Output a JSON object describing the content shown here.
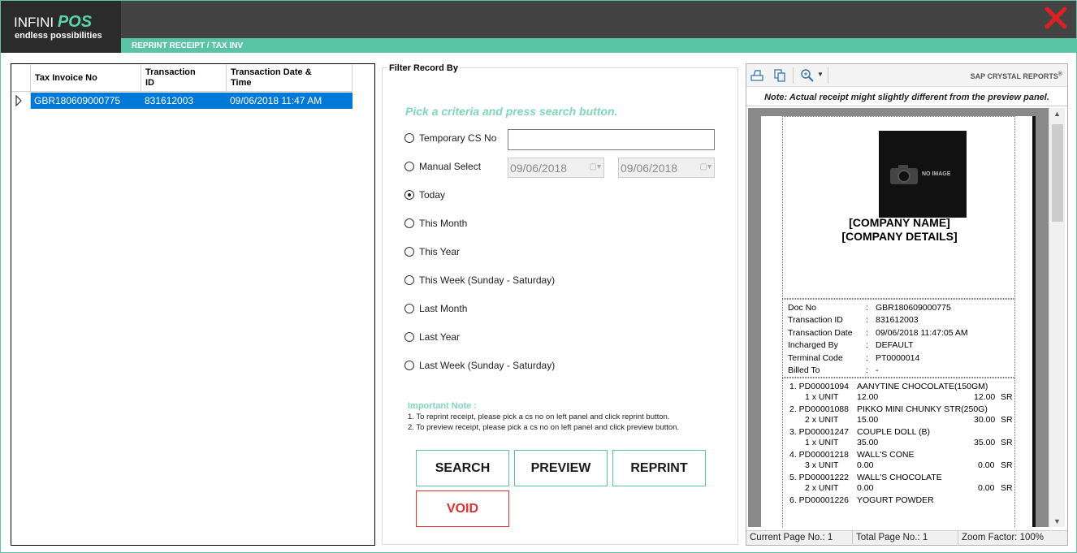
{
  "header": {
    "logo_brand": "INFINI",
    "logo_pos": "POS",
    "logo_tagline": "endless possibilities",
    "subtitle": "REPRINT RECEIPT / TAX INV"
  },
  "grid": {
    "columns": [
      "Tax Invoice No",
      "Transaction ID",
      "Transaction Date & Time"
    ],
    "col_id_l1": "Transaction",
    "col_id_l2": "ID",
    "col_dt_l1": "Transaction Date &",
    "col_dt_l2": "Time",
    "rows": [
      {
        "tax_invoice_no": "GBR180609000775",
        "transaction_id": "831612003",
        "transaction_dt": "09/06/2018 11:47 AM"
      }
    ]
  },
  "filter": {
    "legend": "Filter Record By",
    "hint": "Pick a criteria and press search button.",
    "options": [
      "Temporary CS No",
      "Manual Select",
      "Today",
      "This Month",
      "This Year",
      "This Week (Sunday - Saturday)",
      "Last Month",
      "Last Year",
      "Last Week (Sunday - Saturday)"
    ],
    "selected": "Today",
    "temp_cs_value": "",
    "date_from": "09/06/2018",
    "date_to": "09/06/2018",
    "note_title": "Important Note :",
    "note_1": "1. To reprint receipt, please pick a cs no on left panel and click reprint button.",
    "note_2": "2. To preview receipt, please pick a cs no on left panel and click preview button."
  },
  "buttons": {
    "search": "SEARCH",
    "preview": "PREVIEW",
    "reprint": "REPRINT",
    "void": "VOID"
  },
  "viewer": {
    "brand": "SAP CRYSTAL REPORTS",
    "brand_mark": "®",
    "note": "Note: Actual receipt might slightly different from the preview panel.",
    "current_page": "Current Page No.: 1",
    "total_page": "Total Page No.: 1",
    "zoom": "Zoom Factor: 100%"
  },
  "receipt": {
    "no_image": "NO IMAGE",
    "company_name": "[COMPANY NAME]",
    "company_details": "[COMPANY DETAILS]",
    "fields": [
      {
        "label": "Doc No",
        "value": "GBR180609000775"
      },
      {
        "label": "Transaction ID",
        "value": "831612003"
      },
      {
        "label": "Transaction Date",
        "value": "09/06/2018 11:47:05 AM"
      },
      {
        "label": "Incharged By",
        "value": "DEFAULT"
      },
      {
        "label": "Terminal Code",
        "value": "PT0000014"
      },
      {
        "label": "Billed To",
        "value": "-"
      }
    ],
    "items": [
      {
        "line1": "1. PD00001094",
        "name": "AANYTINE CHOCOLATE(150GM)",
        "qty": "1 x UNIT",
        "price": "12.00",
        "amount": "12.00",
        "tax": "SR"
      },
      {
        "line1": "2. PD00001088",
        "name": "PIKKO MINI CHUNKY STR(250G)",
        "qty": "2 x UNIT",
        "price": "15.00",
        "amount": "30.00",
        "tax": "SR"
      },
      {
        "line1": "3. PD00001247",
        "name": "COUPLE DOLL (B)",
        "qty": "1 x UNIT",
        "price": "35.00",
        "amount": "35.00",
        "tax": "SR"
      },
      {
        "line1": "4. PD00001218",
        "name": "WALL'S CONE",
        "qty": "3 x UNIT",
        "price": "0.00",
        "amount": "0.00",
        "tax": "SR"
      },
      {
        "line1": "5. PD00001222",
        "name": "WALL'S CHOCOLATE",
        "qty": "2 x UNIT",
        "price": "0.00",
        "amount": "0.00",
        "tax": "SR"
      },
      {
        "line1": "6. PD00001226",
        "name": "YOGURT POWDER",
        "qty": "",
        "price": "",
        "amount": "",
        "tax": ""
      }
    ]
  },
  "colors": {
    "accent": "#5bc4a4",
    "titlebar": "#434343",
    "selection": "#0078d7",
    "close": "#e02020",
    "void": "#e03030"
  }
}
